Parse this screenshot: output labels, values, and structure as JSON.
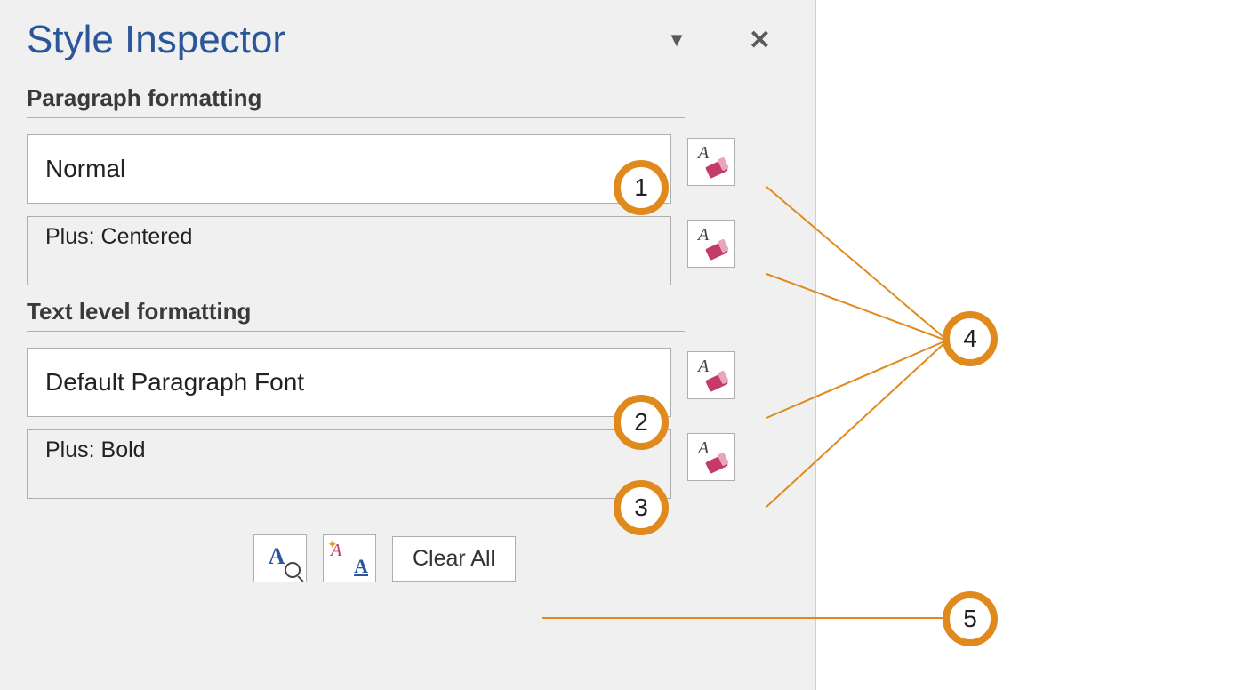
{
  "title": "Style Inspector",
  "sections": {
    "paragraph": {
      "label": "Paragraph formatting",
      "style": "Normal",
      "plus": "Plus: Centered"
    },
    "text": {
      "label": "Text level formatting",
      "style": "Default Paragraph Font",
      "plus": "Plus: Bold"
    }
  },
  "buttons": {
    "clear_all": "Clear All"
  },
  "callouts": {
    "c1": "1",
    "c2": "2",
    "c3": "3",
    "c4": "4",
    "c5": "5"
  }
}
